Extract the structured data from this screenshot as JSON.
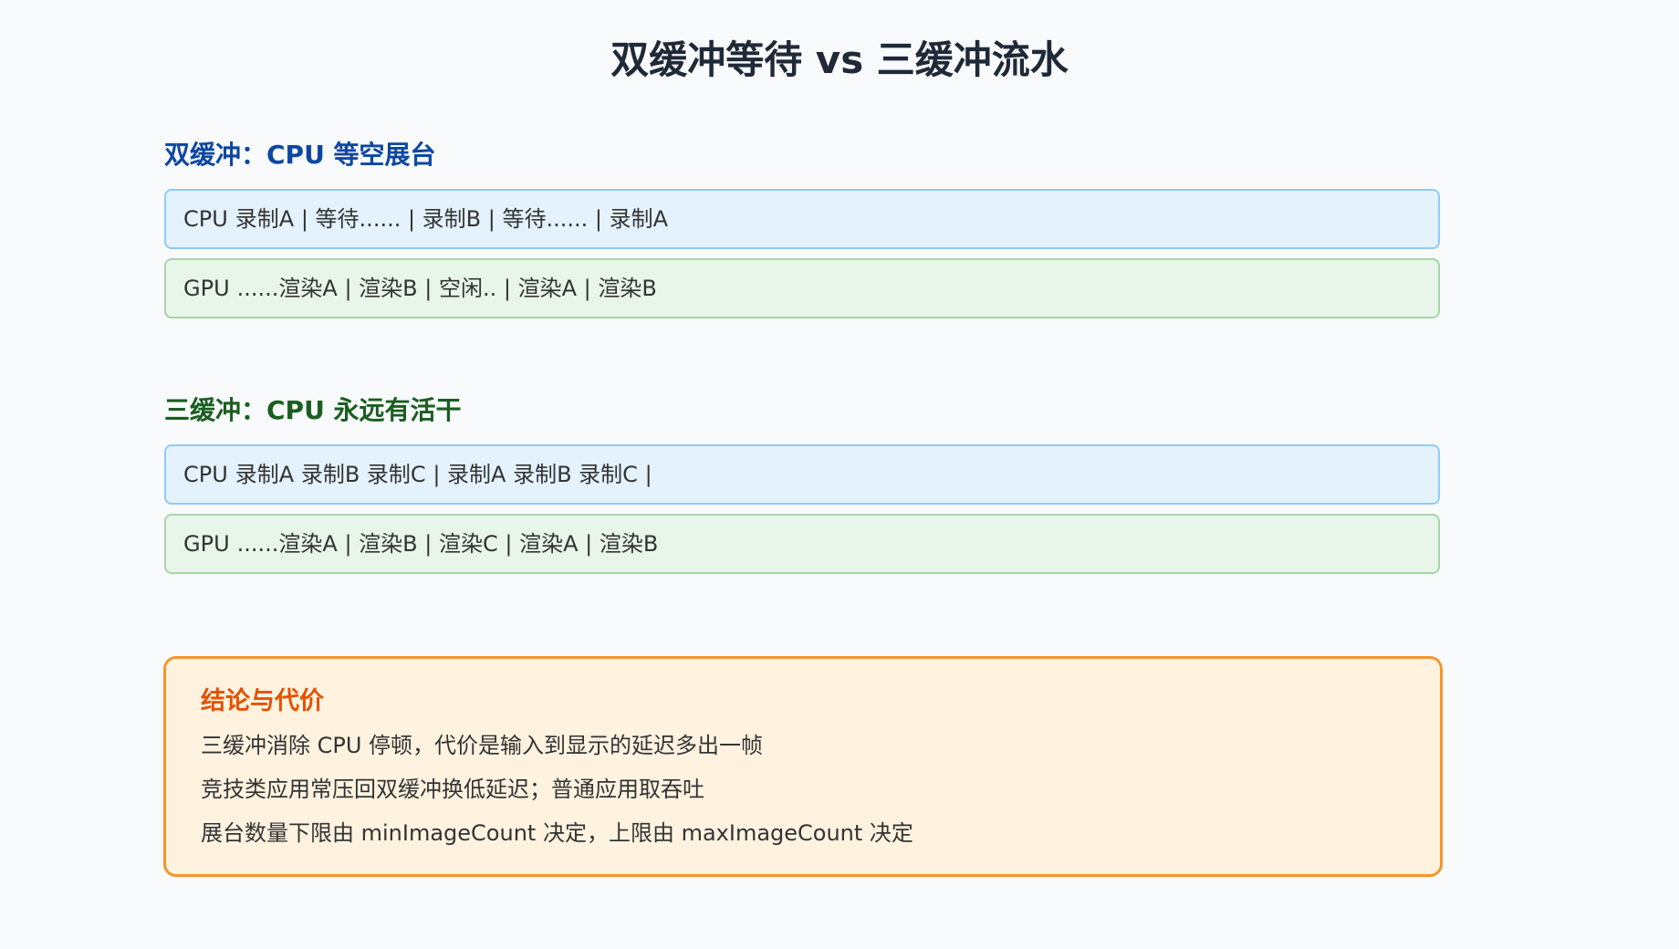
{
  "title": "双缓冲等待 vs 三缓冲流水",
  "colors": {
    "double_title": "#0d47a1",
    "triple_title": "#1b5e20",
    "conclusion_title": "#e65100",
    "cpu_lane_bg": "#e3f2fd",
    "cpu_lane_border": "#90caf9",
    "gpu_lane_bg": "#e8f5e9",
    "gpu_lane_border": "#a5d6a7",
    "conclusion_bg": "#fff3e0",
    "conclusion_border": "#f5952a"
  },
  "double_buffer": {
    "title": "双缓冲：CPU 等空展台",
    "cpu": {
      "label": "CPU",
      "timeline": "录制A | 等待...... | 录制B | 等待...... | 录制A"
    },
    "gpu": {
      "label": "GPU",
      "timeline": "......渲染A | 渲染B | 空闲.. | 渲染A | 渲染B"
    }
  },
  "triple_buffer": {
    "title": "三缓冲：CPU 永远有活干",
    "cpu": {
      "label": "CPU",
      "timeline": "录制A 录制B 录制C | 录制A 录制B 录制C |"
    },
    "gpu": {
      "label": "GPU",
      "timeline": "......渲染A | 渲染B | 渲染C | 渲染A | 渲染B"
    }
  },
  "conclusion": {
    "title": "结论与代价",
    "lines": [
      "三缓冲消除 CPU 停顿，代价是输入到显示的延迟多出一帧",
      "竞技类应用常压回双缓冲换低延迟；普通应用取吞吐",
      "展台数量下限由 minImageCount 决定，上限由 maxImageCount 决定"
    ]
  }
}
